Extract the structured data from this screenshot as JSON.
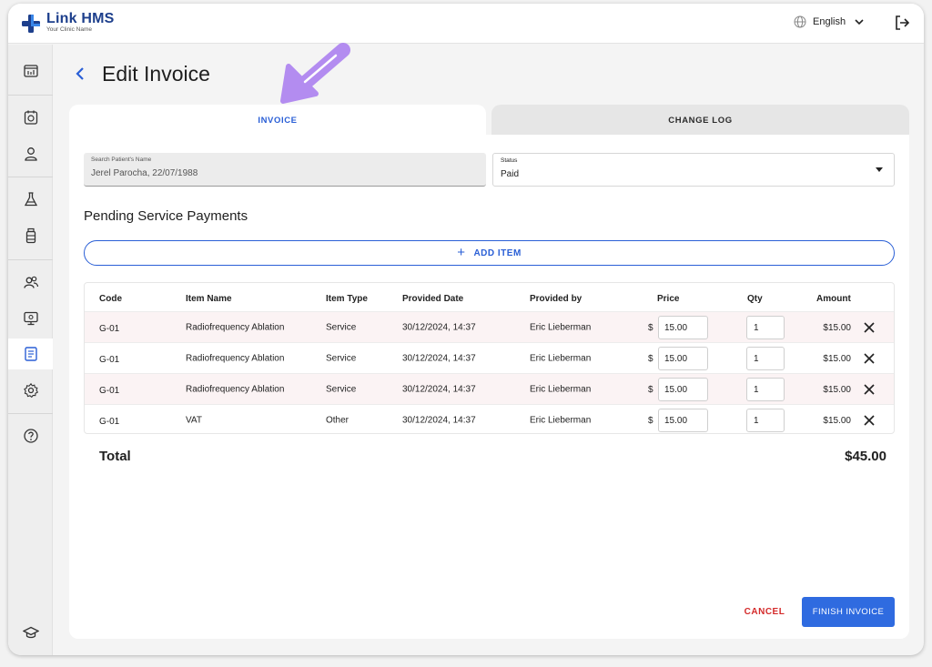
{
  "app": {
    "name": "Link HMS",
    "subtitle": "Your Clinic Name"
  },
  "header": {
    "language": "English"
  },
  "page": {
    "title": "Edit Invoice"
  },
  "tabs": [
    {
      "label": "INVOICE",
      "active": true
    },
    {
      "label": "CHANGE LOG",
      "active": false
    }
  ],
  "form": {
    "patient": {
      "label": "Search Patient's Name",
      "value": "Jerel Parocha, 22/07/1988"
    },
    "status": {
      "label": "Status",
      "value": "Paid"
    }
  },
  "section": {
    "title": "Pending Service Payments",
    "add_item": "ADD ITEM"
  },
  "table": {
    "columns": [
      "Code",
      "Item Name",
      "Item Type",
      "Provided Date",
      "Provided by",
      "Price",
      "Qty",
      "Amount"
    ],
    "rows": [
      {
        "code": "G-01",
        "name": "Radiofrequency Ablation",
        "type": "Service",
        "date": "30/12/2024, 14:37",
        "by": "Eric Lieberman",
        "currency": "$",
        "price": "15.00",
        "qty": "1",
        "amount": "$15.00"
      },
      {
        "code": "G-01",
        "name": "Radiofrequency Ablation",
        "type": "Service",
        "date": "30/12/2024, 14:37",
        "by": "Eric Lieberman",
        "currency": "$",
        "price": "15.00",
        "qty": "1",
        "amount": "$15.00"
      },
      {
        "code": "G-01",
        "name": "Radiofrequency Ablation",
        "type": "Service",
        "date": "30/12/2024, 14:37",
        "by": "Eric Lieberman",
        "currency": "$",
        "price": "15.00",
        "qty": "1",
        "amount": "$15.00"
      },
      {
        "code": "G-01",
        "name": "VAT",
        "type": "Other",
        "date": "30/12/2024, 14:37",
        "by": "Eric Lieberman",
        "currency": "$",
        "price": "15.00",
        "qty": "1",
        "amount": "$15.00"
      }
    ]
  },
  "total": {
    "label": "Total",
    "value": "$45.00"
  },
  "actions": {
    "cancel": "CANCEL",
    "finish": "FINISH INVOICE"
  },
  "colors": {
    "primary": "#2f6be0",
    "brand": "#1d3f8c",
    "danger": "#d42a2a",
    "annotation": "#b38cf0"
  },
  "icons": {
    "sidebar": [
      "dashboard-icon",
      "calendar-icon",
      "patient-icon",
      "lab-flask-icon",
      "pharmacy-bottle-icon",
      "users-group-icon",
      "monitor-icon",
      "invoice-icon",
      "settings-icon",
      "help-icon",
      "graduation-cap-icon"
    ]
  }
}
